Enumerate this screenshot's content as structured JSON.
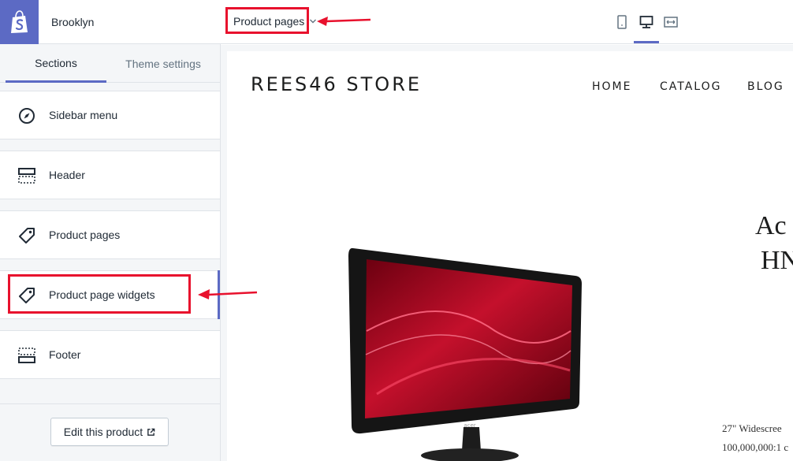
{
  "app": {
    "theme_name": "Brooklyn",
    "accent_color": "#5c6ac4",
    "logo_icon": "shopify-bag-icon"
  },
  "tabs": {
    "sections": "Sections",
    "theme_settings": "Theme settings"
  },
  "sections": [
    {
      "label": "Sidebar menu",
      "icon": "compass-icon"
    },
    {
      "label": "Header",
      "icon": "header-layout-icon"
    },
    {
      "label": "Product pages",
      "icon": "tag-icon"
    },
    {
      "label": "Product page widgets",
      "icon": "tag-icon",
      "selected": true
    },
    {
      "label": "Footer",
      "icon": "footer-layout-icon"
    }
  ],
  "footer": {
    "edit_button": "Edit this product",
    "edit_icon": "external-link-icon"
  },
  "topbar": {
    "page_selector": "Product pages",
    "view_modes": [
      "mobile-view-icon",
      "desktop-view-icon",
      "fullwidth-view-icon"
    ],
    "active_view": "desktop"
  },
  "preview": {
    "store_name": "REES46 STORE",
    "nav": [
      "HOME",
      "CATALOG",
      "BLOG"
    ],
    "product_title_line1": "Ac",
    "product_title_line2": "HN",
    "description_line1": "27\" Widescree",
    "description_line2": "100,000,000:1 c"
  },
  "annotation_color": "#e8112d"
}
